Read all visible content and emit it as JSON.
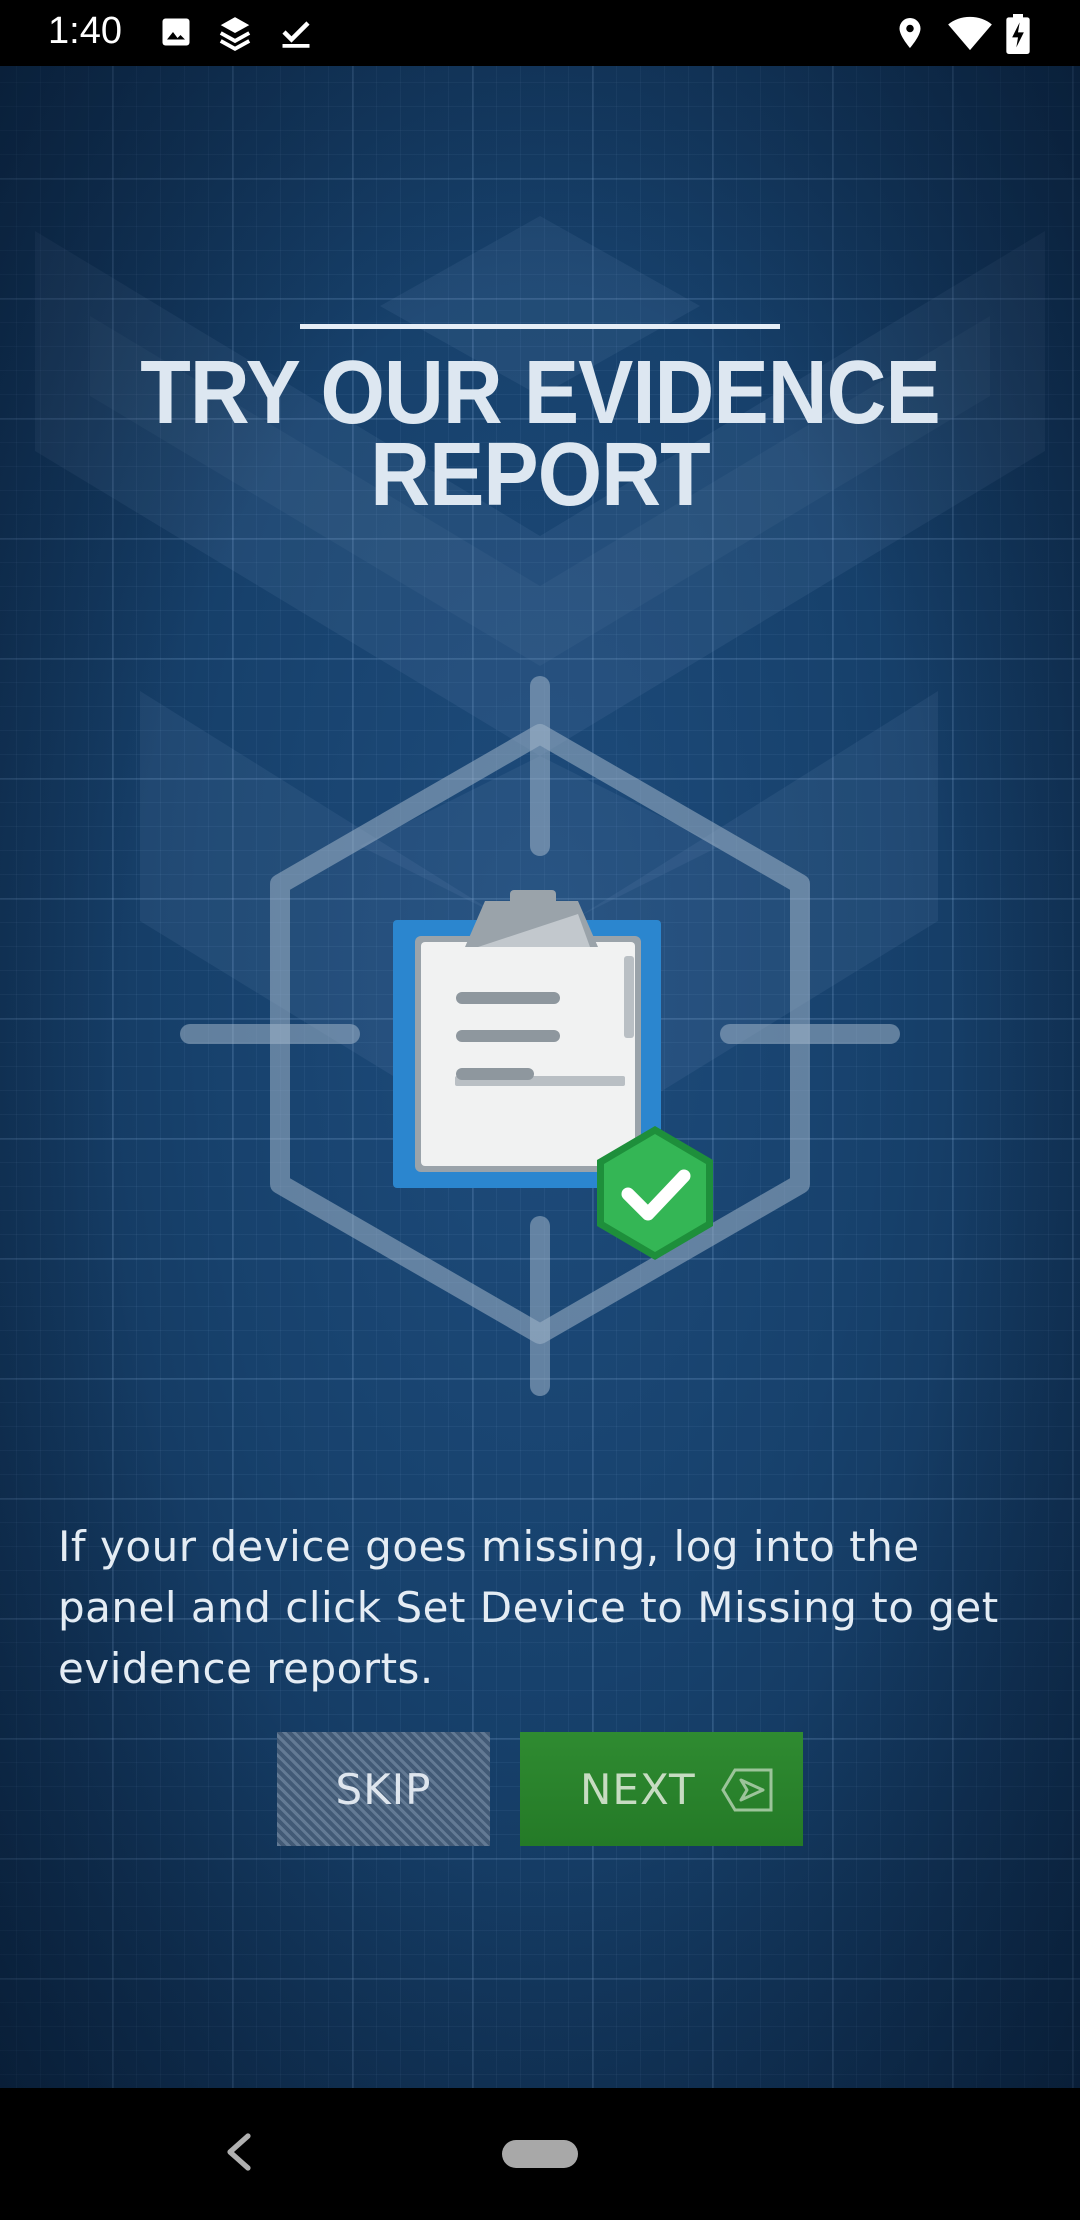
{
  "status_bar": {
    "time": "1:40",
    "left_icons": [
      "image-icon",
      "layers-icon",
      "check-icon"
    ],
    "right_icons": [
      "location-icon",
      "wifi-icon",
      "battery-charging-icon"
    ]
  },
  "onboarding": {
    "title": "TRY OUR EVIDENCE REPORT",
    "illustration_icons": [
      "clipboard-icon",
      "green-check-badge-icon"
    ],
    "description": "If your device goes missing, log into the panel and click Set Device to Missing to get evidence reports.",
    "skip_label": "SKIP",
    "next_label": "NEXT",
    "next_icon": "send-arrow-icon"
  },
  "nav_bar": {
    "back_icon": "back-chevron-icon",
    "home_icon": "home-pill-icon"
  },
  "colors": {
    "background": "#17416c",
    "next_button": "#2a842c",
    "skip_button": "#405a77",
    "check_badge": "#2ea84a"
  }
}
